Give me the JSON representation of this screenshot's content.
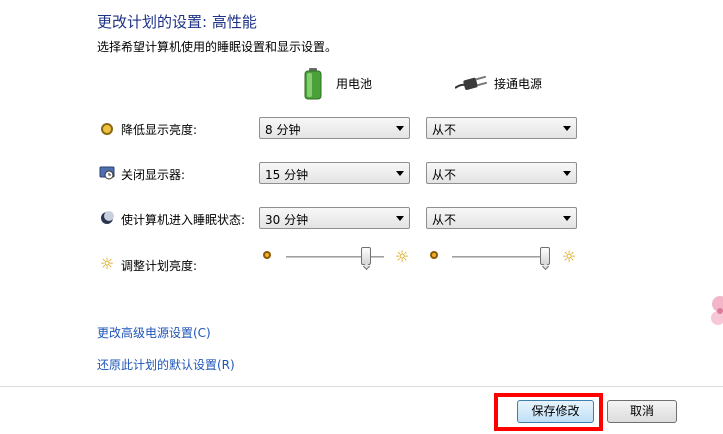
{
  "header": {
    "title": "更改计划的设置: 高性能",
    "subtitle": "选择希望计算机使用的睡眠设置和显示设置。"
  },
  "columns": {
    "battery": "用电池",
    "plugged": "接通电源"
  },
  "rows": [
    {
      "label": "降低显示亮度:",
      "battery": "8 分钟",
      "plugged": "从不"
    },
    {
      "label": "关闭显示器:",
      "battery": "15 分钟",
      "plugged": "从不"
    },
    {
      "label": "使计算机进入睡眠状态:",
      "battery": "30 分钟",
      "plugged": "从不"
    }
  ],
  "brightness": {
    "label": "调整计划亮度:",
    "battery_level": 0.85,
    "plugged_level": 1.0
  },
  "links": {
    "advanced": "更改高级电源设置(C)",
    "restore": "还原此计划的默认设置(R)"
  },
  "footer": {
    "save": "保存修改",
    "cancel": "取消"
  },
  "colors": {
    "title": "#1e3287",
    "link": "#1f55b8",
    "highlight": "#ff0000"
  }
}
